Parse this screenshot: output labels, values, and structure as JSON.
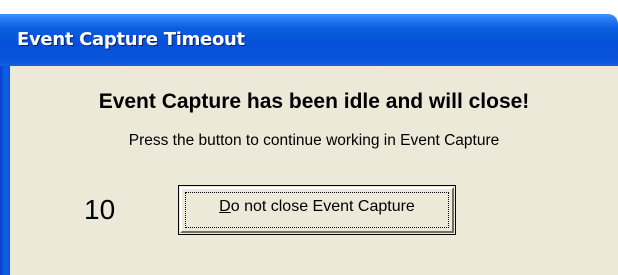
{
  "window": {
    "title": "Event Capture Timeout"
  },
  "dialog": {
    "heading": "Event Capture has been idle and will close!",
    "message": "Press the button to continue working in Event Capture",
    "countdown": "10",
    "button": {
      "mnemonic": "D",
      "label_rest": "o not close Event Capture"
    }
  },
  "colors": {
    "titlebar": "#0550d8",
    "client_background": "#ece9d8",
    "frame": "#0a57e0"
  }
}
